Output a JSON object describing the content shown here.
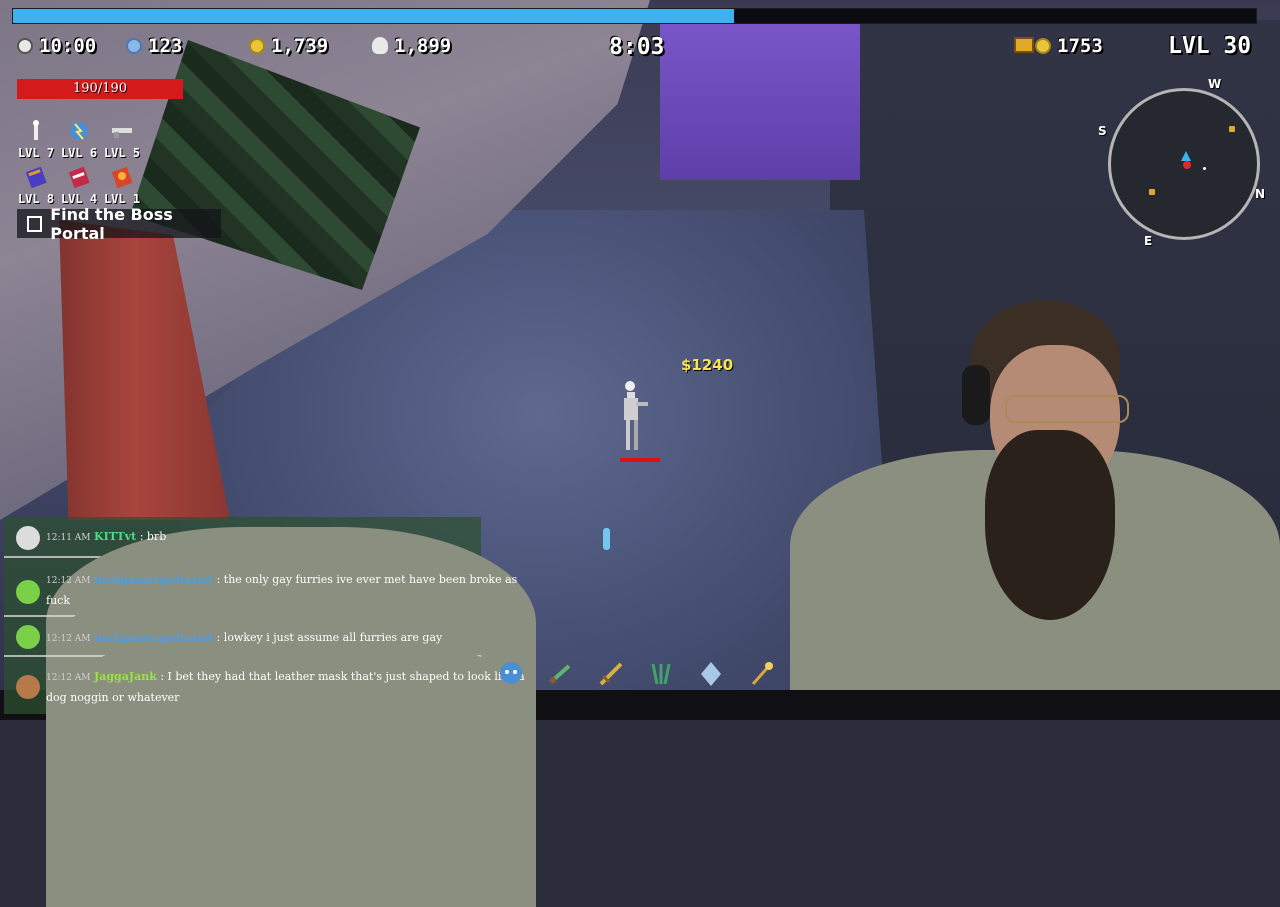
{
  "hud": {
    "timer": "10:00",
    "gems": "123",
    "gold": "1,739",
    "kills": "1,899",
    "stage_time": "8:03",
    "chest_gold": "1753",
    "level": "LVL 30",
    "xp_progress": 0.58,
    "hp": "190/190",
    "hp_fraction": 1.0
  },
  "weapons": [
    {
      "icon": "bone-icon",
      "level": "LVL 7"
    },
    {
      "icon": "lightning-orb-icon",
      "level": "LVL 6"
    },
    {
      "icon": "revolver-icon",
      "level": "LVL 5"
    }
  ],
  "tomes": [
    {
      "icon": "blue-tome-icon",
      "level": "LVL 8"
    },
    {
      "icon": "red-tome-icon",
      "level": "LVL 4"
    },
    {
      "icon": "fire-tome-icon",
      "level": "LVL 1"
    }
  ],
  "quest": {
    "label": "Find the Boss Portal",
    "completed": false
  },
  "minimap": {
    "north": "N",
    "south": "S",
    "east": "E",
    "west": "W"
  },
  "world": {
    "money_popup": "$1240"
  },
  "chat": [
    {
      "time": "12:11 AM",
      "user": "KITTvt",
      "user_color": "#45e08a",
      "text": ": brb"
    },
    {
      "time": "12:12 AM",
      "user": "nickgamerguitarist",
      "user_color": "#4aa0e6",
      "text": ": the only gay furries ive ever met have been broke as fuck"
    },
    {
      "time": "12:12 AM",
      "user": "nickgamerguitarist",
      "user_color": "#4aa0e6",
      "text": ": lowkey i just assume all furries are gay"
    },
    {
      "time": "12:12 AM",
      "user": "JaggaJank",
      "user_color": "#9be24a",
      "text": ": I bet they had that leather mask that's just shaped to look like a dog noggin or whatever"
    }
  ],
  "hotbar": [
    "ice-skull-icon",
    "green-dagger-icon",
    "golden-sword-icon",
    "green-claw-icon",
    "crystal-icon",
    "golden-staff-icon"
  ],
  "colors": {
    "xp": "#3fb1ef",
    "hp": "#d41a1a",
    "money": "#f6e455",
    "chat_bg": "#2d5030"
  }
}
